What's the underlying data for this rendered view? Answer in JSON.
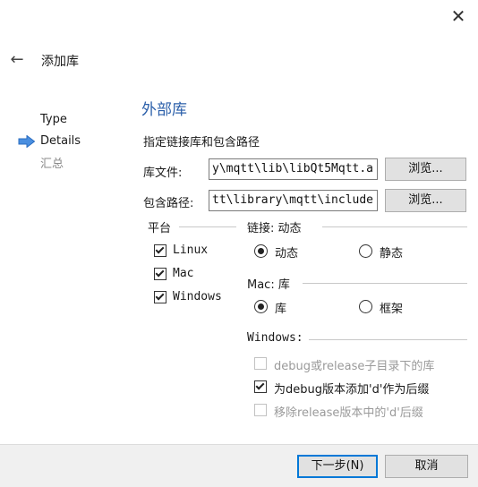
{
  "window": {
    "close_glyph": "✕"
  },
  "header": {
    "title": "添加库",
    "back_glyph": "←"
  },
  "steps": [
    {
      "label": "Type",
      "state": "done"
    },
    {
      "label": "Details",
      "state": "current"
    },
    {
      "label": "汇总",
      "state": "future"
    }
  ],
  "page": {
    "title": "外部库",
    "intro": "指定链接库和包含路径",
    "library_file": {
      "label": "库文件:",
      "value": "y\\mqtt\\lib\\libQt5Mqtt.a",
      "browse_label": "浏览..."
    },
    "include_path": {
      "label": "包含路径:",
      "value": "tt\\library\\mqtt\\include",
      "browse_label": "浏览..."
    }
  },
  "platform": {
    "title": "平台",
    "items": [
      {
        "label": "Linux",
        "checked": true
      },
      {
        "label": "Mac",
        "checked": true
      },
      {
        "label": "Windows",
        "checked": true
      }
    ]
  },
  "linkage": {
    "title": "链接: 动态",
    "options": [
      {
        "label": "动态",
        "selected": true
      },
      {
        "label": "静态",
        "selected": false
      }
    ]
  },
  "mac": {
    "title": "Mac: 库",
    "options": [
      {
        "label": "库",
        "selected": true
      },
      {
        "label": "框架",
        "selected": false
      }
    ]
  },
  "windows": {
    "title": "Windows:",
    "options": [
      {
        "label": "debug或release子目录下的库",
        "checked": false,
        "enabled": false
      },
      {
        "label": "为debug版本添加'd'作为后缀",
        "checked": true,
        "enabled": true
      },
      {
        "label": "移除release版本中的'd'后缀",
        "checked": false,
        "enabled": false
      }
    ]
  },
  "footer": {
    "next_label": "下一步(N)",
    "cancel_label": "取消"
  }
}
